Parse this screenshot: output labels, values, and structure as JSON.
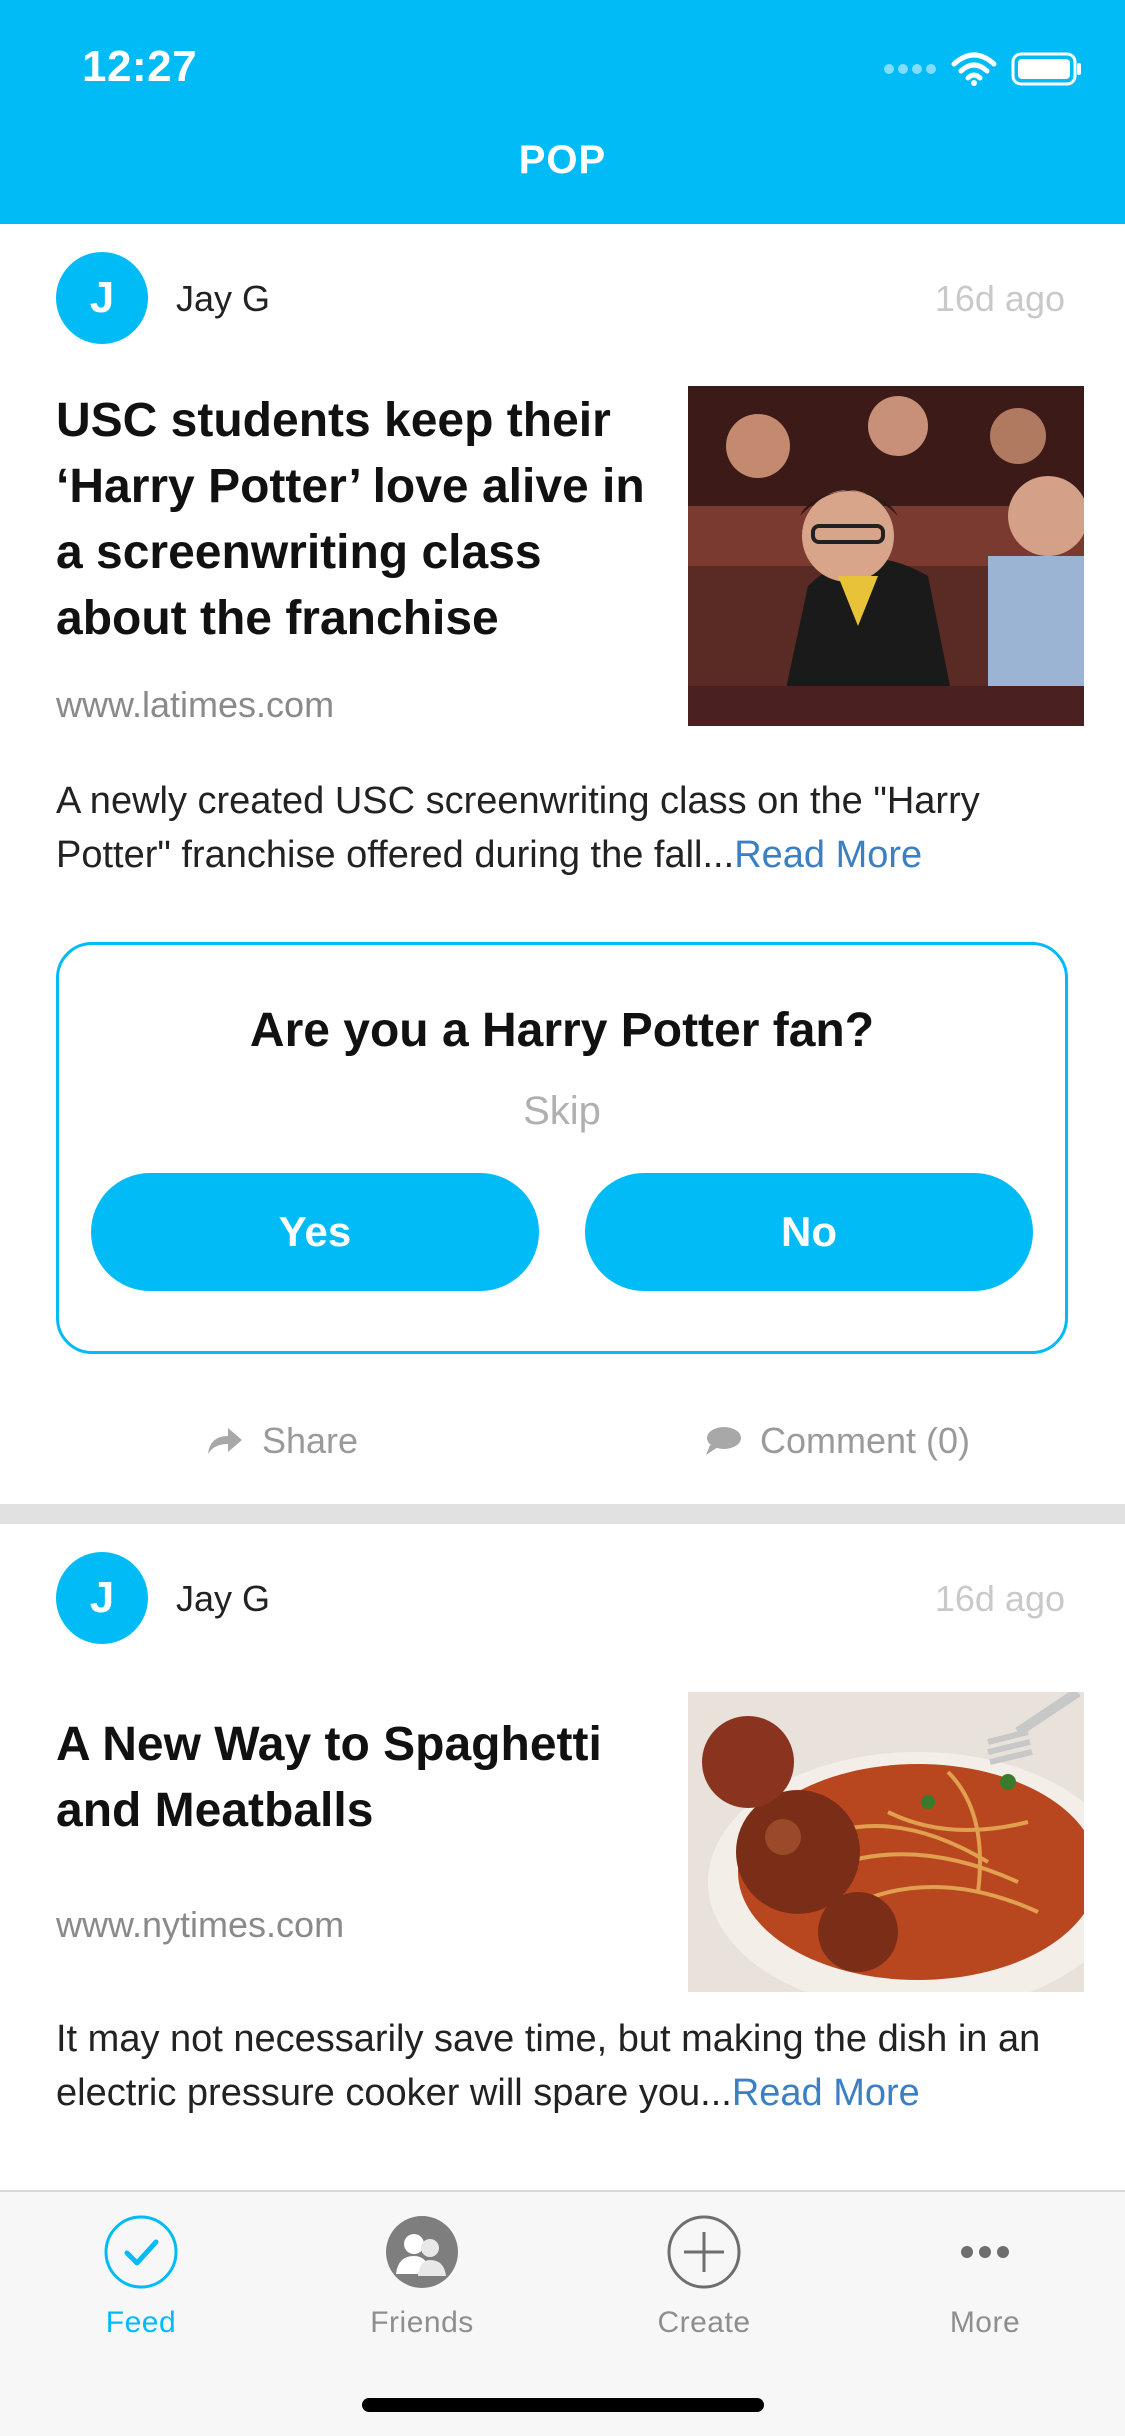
{
  "status_bar": {
    "time": "12:27"
  },
  "header": {
    "title": "POP"
  },
  "posts": [
    {
      "avatar_initial": "J",
      "author": "Jay G",
      "time": "16d ago",
      "headline": "USC students keep their ‘Harry Potter’ love alive in a screenwriting class about the franchise",
      "source": "www.latimes.com",
      "description": "A newly created USC screenwriting class on the \"Harry Potter\" franchise offered during the fall...",
      "read_more": "Read More",
      "poll": {
        "question": "Are you a Harry Potter fan?",
        "skip": "Skip",
        "yes": "Yes",
        "no": "No"
      },
      "actions": {
        "share": "Share",
        "comment": "Comment (0)"
      }
    },
    {
      "avatar_initial": "J",
      "author": "Jay G",
      "time": "16d ago",
      "headline": "A New Way to Spaghetti and Meatballs",
      "source": "www.nytimes.com",
      "description": "It may not necessarily save time, but making the dish in an electric pressure cooker will spare you...",
      "read_more": "Read More"
    }
  ],
  "tabbar": {
    "items": [
      {
        "label": "Feed",
        "icon": "check-circle-icon",
        "active": true
      },
      {
        "label": "Friends",
        "icon": "friends-icon",
        "active": false
      },
      {
        "label": "Create",
        "icon": "plus-circle-icon",
        "active": false
      },
      {
        "label": "More",
        "icon": "ellipsis-icon",
        "active": false
      }
    ]
  },
  "colors": {
    "accent": "#00BBF6",
    "link": "#3A80C2",
    "muted": "#8E8E8E"
  }
}
